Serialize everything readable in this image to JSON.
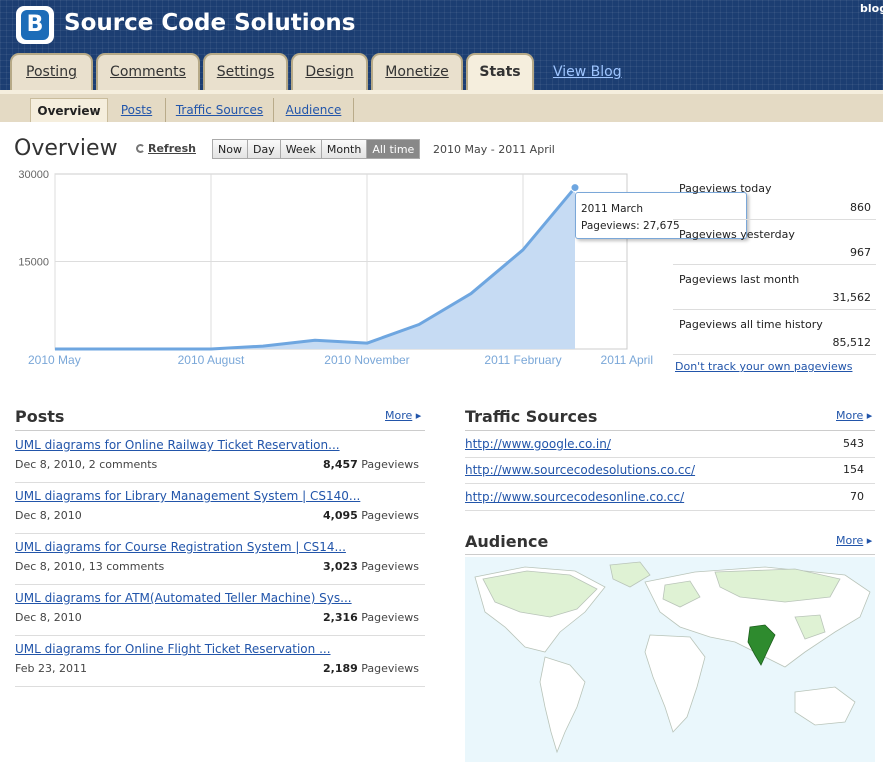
{
  "header": {
    "blog_title": "Source Code Solutions",
    "corner_link": "blog",
    "logo_letter": "B",
    "tabs": [
      {
        "label": "Posting"
      },
      {
        "label": "Comments"
      },
      {
        "label": "Settings"
      },
      {
        "label": "Design"
      },
      {
        "label": "Monetize"
      },
      {
        "label": "Stats",
        "active": true
      }
    ],
    "view_blog": "View Blog"
  },
  "subtabs": [
    {
      "label": "Overview",
      "active": true
    },
    {
      "label": "Posts"
    },
    {
      "label": "Traffic Sources"
    },
    {
      "label": "Audience"
    }
  ],
  "overview": {
    "title": "Overview",
    "refresh_label": "Refresh",
    "range_buttons": [
      "Now",
      "Day",
      "Week",
      "Month",
      "All time"
    ],
    "active_range": "All time",
    "date_range": "2010 May - 2011 April"
  },
  "chart_data": {
    "type": "area",
    "x_tick_labels": [
      "2010 May",
      "2010 August",
      "2010 November",
      "2011 February",
      "2011 April"
    ],
    "y_tick_labels": [
      "30000",
      "15000"
    ],
    "ylim": [
      0,
      30000
    ],
    "x": [
      "2010 May",
      "2010 Jun",
      "2010 Jul",
      "2010 August",
      "2010 Sep",
      "2010 Oct",
      "2010 November",
      "2010 Dec",
      "2011 Jan",
      "2011 February",
      "2011 March",
      "2011 April"
    ],
    "values": [
      0,
      0,
      0,
      0,
      500,
      1500,
      1000,
      4200,
      9500,
      17000,
      27675,
      null
    ],
    "color": "#6ea6e0",
    "fill": "#c6dbf3",
    "tooltip": {
      "title": "2011 March",
      "text": "Pageviews: 27,675"
    }
  },
  "stats": [
    {
      "label": "Pageviews today",
      "value": "860"
    },
    {
      "label": "Pageviews yesterday",
      "value": "967"
    },
    {
      "label": "Pageviews last month",
      "value": "31,562"
    },
    {
      "label": "Pageviews all time history",
      "value": "85,512"
    }
  ],
  "dont_track": "Don't track your own pageviews",
  "posts": {
    "title": "Posts",
    "more": "More",
    "items": [
      {
        "title": "UML diagrams for Online Railway Ticket Reservation...",
        "meta": "Dec 8, 2010, 2 comments",
        "views": "8,457",
        "unit": "Pageviews"
      },
      {
        "title": "UML diagrams for Library Management System | CS140...",
        "meta": "Dec 8, 2010",
        "views": "4,095",
        "unit": "Pageviews"
      },
      {
        "title": "UML diagrams for Course Registration System | CS14...",
        "meta": "Dec 8, 2010, 13 comments",
        "views": "3,023",
        "unit": "Pageviews"
      },
      {
        "title": "UML diagrams for ATM(Automated Teller Machine) Sys...",
        "meta": "Dec 8, 2010",
        "views": "2,316",
        "unit": "Pageviews"
      },
      {
        "title": "UML diagrams for Online Flight Ticket Reservation ...",
        "meta": "Feb 23, 2011",
        "views": "2,189",
        "unit": "Pageviews"
      }
    ]
  },
  "traffic": {
    "title": "Traffic Sources",
    "more": "More",
    "items": [
      {
        "url": "http://www.google.co.in/",
        "count": "543"
      },
      {
        "url": "http://www.sourcecodesolutions.co.cc/",
        "count": "154"
      },
      {
        "url": "http://www.sourcecodesonline.co.cc/",
        "count": "70"
      }
    ]
  },
  "audience": {
    "title": "Audience",
    "more": "More",
    "highlight_color": "#2e8b2e"
  }
}
